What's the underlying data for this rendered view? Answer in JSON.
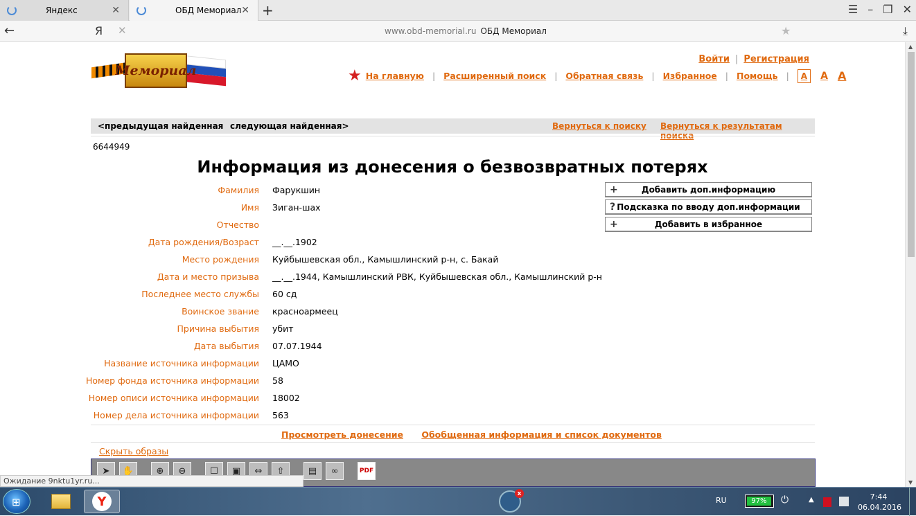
{
  "browser": {
    "tabs": [
      {
        "label": "Яндекс"
      },
      {
        "label": "ОБД Мемориал"
      }
    ],
    "address": {
      "url": "www.obd-memorial.ru",
      "page_title": "ОБД Мемориал"
    },
    "ya_label": "Я"
  },
  "site": {
    "logo_text": "Мемориал",
    "auth": {
      "login": "Войти",
      "register": "Регистрация"
    },
    "nav": {
      "home": "На главную",
      "advanced": "Расширенный поиск",
      "feedback": "Обратная связь",
      "favorites": "Избранное",
      "help": "Помощь",
      "font_a1": "A",
      "font_a2": "A",
      "font_a3": "A"
    },
    "record_nav": {
      "prev": "<предыдущая найденная",
      "next": "следующая найденная>",
      "back_search": "Вернуться к поиску",
      "back_results": "Вернуться к результатам поиска"
    },
    "record_id": "6644949",
    "title": "Информация из донесения о безвозвратных потерях",
    "fields": [
      {
        "label": "Фамилия",
        "value": "Фарукшин"
      },
      {
        "label": "Имя",
        "value": "Зиган-шах"
      },
      {
        "label": "Отчество",
        "value": ""
      },
      {
        "label": "Дата рождения/Возраст",
        "value": "__.__.1902"
      },
      {
        "label": "Место рождения",
        "value": "Куйбышевская обл., Камышлинский р-н, с. Бакай"
      },
      {
        "label": "Дата и место призыва",
        "value": "__.__.1944, Камышлинский РВК, Куйбышевская обл., Камышлинский р-н"
      },
      {
        "label": "Последнее место службы",
        "value": "60 сд"
      },
      {
        "label": "Воинское звание",
        "value": "красноармеец"
      },
      {
        "label": "Причина выбытия",
        "value": "убит"
      },
      {
        "label": "Дата выбытия",
        "value": "07.07.1944"
      },
      {
        "label": "Название источника информации",
        "value": "ЦАМО"
      },
      {
        "label": "Номер фонда источника информации",
        "value": "58"
      },
      {
        "label": "Номер описи источника информации",
        "value": "18002"
      },
      {
        "label": "Номер дела источника информации",
        "value": "563"
      }
    ],
    "actions": [
      {
        "icon": "+",
        "label": "Добавить доп.информацию"
      },
      {
        "icon": "?",
        "label": "Подсказка по вводу доп.информации"
      },
      {
        "icon": "+",
        "label": "Добавить в избранное"
      }
    ],
    "links": {
      "view_report": "Просмотреть донесение",
      "summary": "Обобщенная информация и список документов"
    },
    "hide_images": "Скрыть образы",
    "viewer_tools": [
      "pointer-icon",
      "hand-icon",
      "zoom-in-icon",
      "zoom-out-icon",
      "fit-page-icon",
      "actual-size-icon",
      "fit-width-icon",
      "rotate-icon",
      "print-icon",
      "link-icon",
      "pdf-icon"
    ]
  },
  "status_text": "Ожидание 9nktu1yr.ru...",
  "taskbar": {
    "lang": "RU",
    "battery": "97%",
    "time": "7:44",
    "date": "06.04.2016",
    "badge": "x"
  },
  "colors": {
    "accent": "#e06a10",
    "title_red": "#d42020"
  }
}
